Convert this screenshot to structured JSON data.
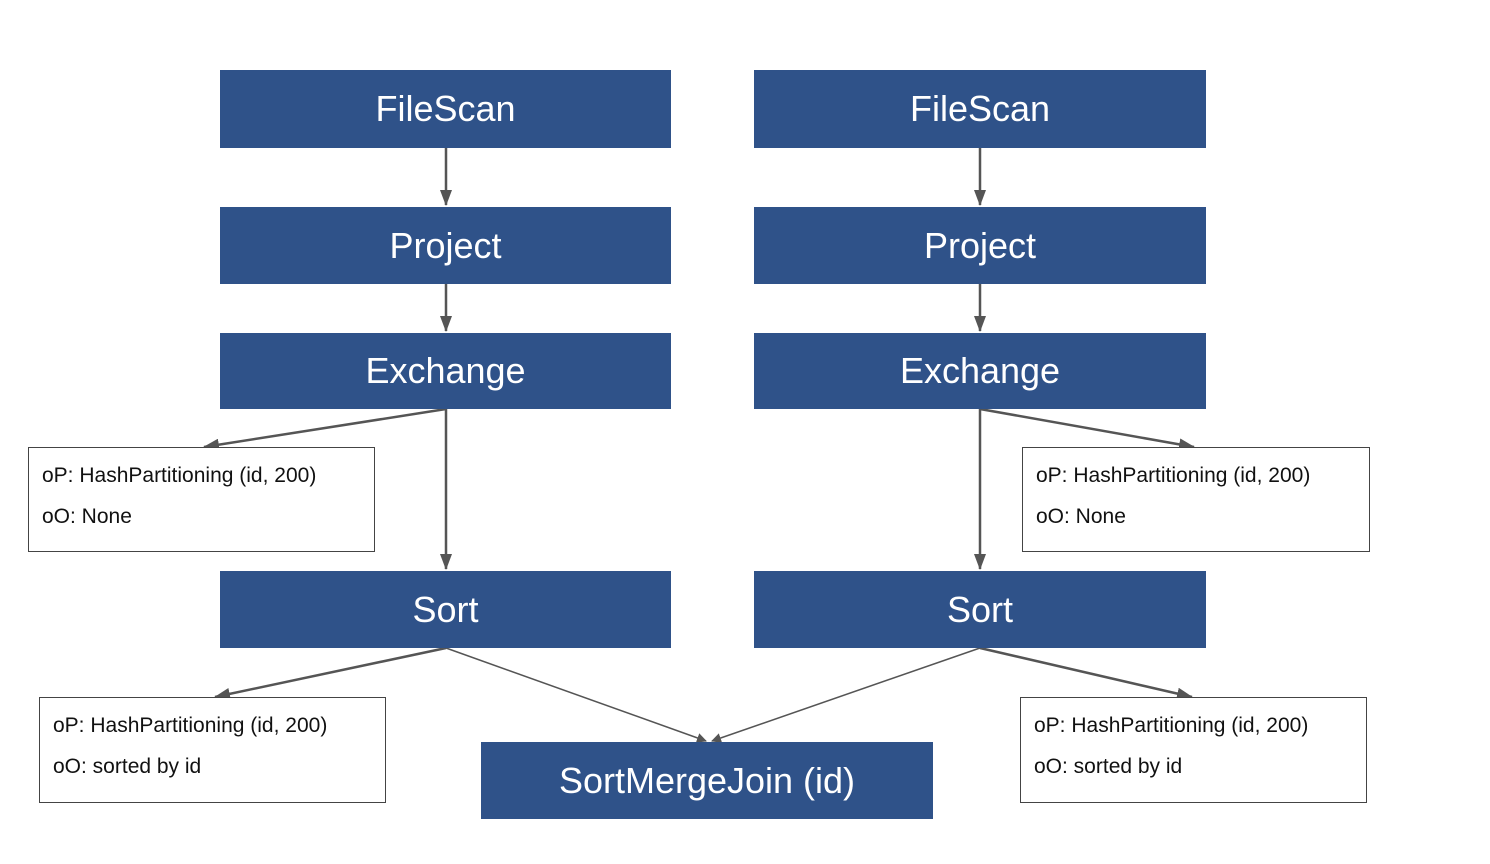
{
  "colors": {
    "node_fill": "#2f5289",
    "node_text": "#ffffff",
    "edge": "#555555",
    "info_border": "#444444"
  },
  "left": {
    "filescan": "FileScan",
    "project": "Project",
    "exchange": "Exchange",
    "sort": "Sort",
    "exchange_info": {
      "op": "oP: HashPartitioning (id, 200)",
      "oo": "oO: None"
    },
    "sort_info": {
      "op": "oP: HashPartitioning (id, 200)",
      "oo": "oO: sorted by id"
    }
  },
  "right": {
    "filescan": "FileScan",
    "project": "Project",
    "exchange": "Exchange",
    "sort": "Sort",
    "exchange_info": {
      "op": "oP: HashPartitioning (id, 200)",
      "oo": "oO: None"
    },
    "sort_info": {
      "op": "oP: HashPartitioning (id, 200)",
      "oo": "oO: sorted by id"
    }
  },
  "join": "SortMergeJoin (id)"
}
